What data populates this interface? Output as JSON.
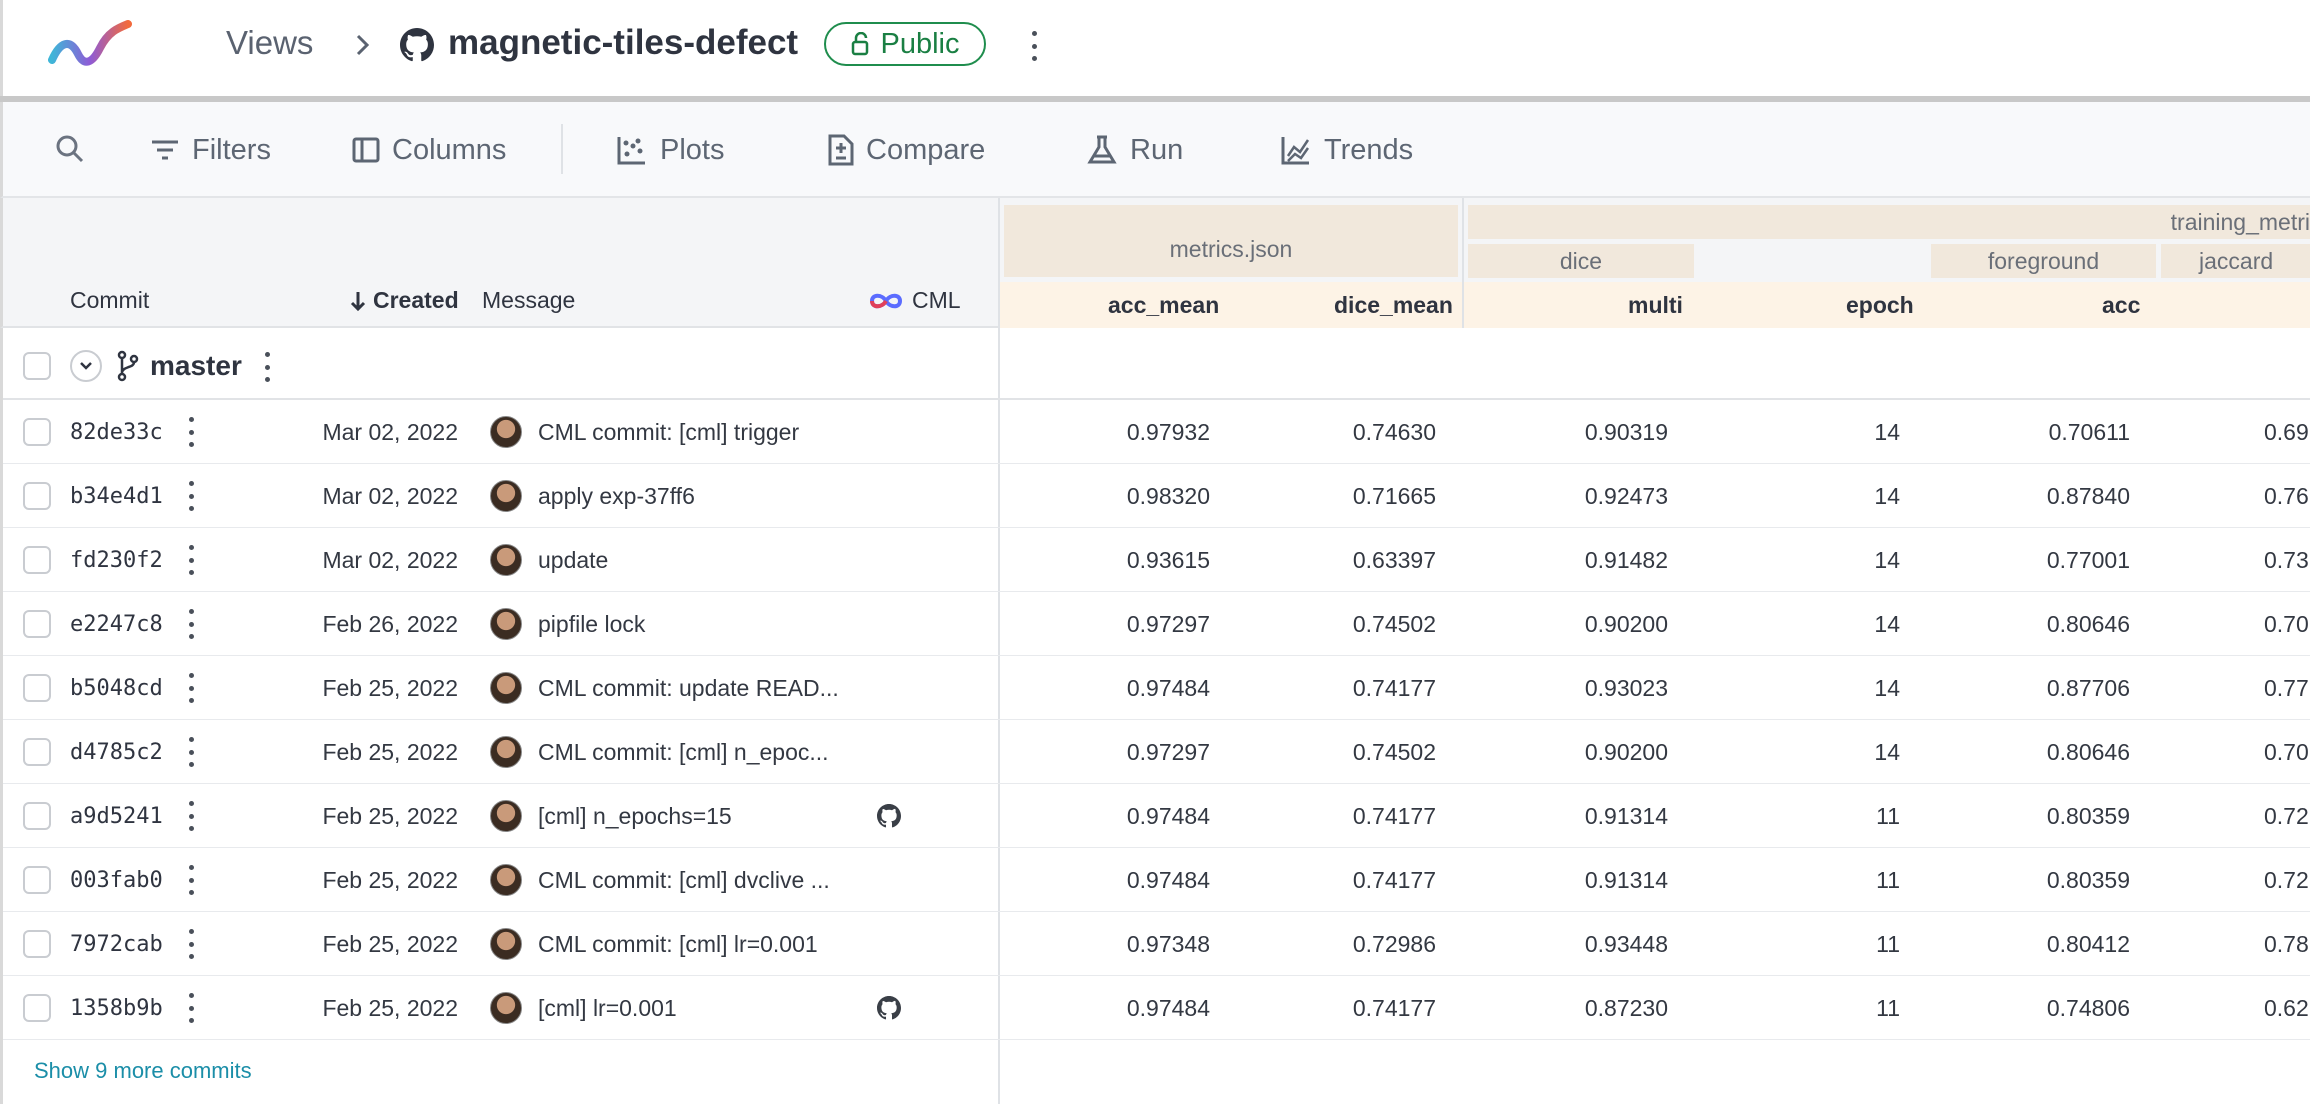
{
  "header": {
    "crumb_views": "Views",
    "repo_name": "magnetic-tiles-defect",
    "visibility_badge": "Public",
    "logo": "dvc-studio-logo"
  },
  "toolbar": {
    "filters": "Filters",
    "columns": "Columns",
    "plots": "Plots",
    "compare": "Compare",
    "run": "Run",
    "trends": "Trends"
  },
  "table": {
    "col_commit": "Commit",
    "col_created": "Created",
    "col_message": "Message",
    "col_cml": "CML",
    "group_metrics_json": "metrics.json",
    "group_training_metrics": "training_metri",
    "subgroup_dice": "dice",
    "subgroup_foreground": "foreground",
    "subgroup_jaccard": "jaccard",
    "metric_cols": [
      "acc_mean",
      "dice_mean",
      "multi",
      "epoch",
      "acc"
    ]
  },
  "branch": {
    "name": "master"
  },
  "rows": [
    {
      "commit": "82de33c",
      "created": "Mar 02, 2022",
      "message": "CML commit: [cml] trigger",
      "cml": false,
      "acc_mean": "0.97932",
      "dice_mean": "0.74630",
      "multi": "0.90319",
      "epoch": "14",
      "acc": "0.70611",
      "next": "0.69"
    },
    {
      "commit": "b34e4d1",
      "created": "Mar 02, 2022",
      "message": "apply exp-37ff6",
      "cml": false,
      "acc_mean": "0.98320",
      "dice_mean": "0.71665",
      "multi": "0.92473",
      "epoch": "14",
      "acc": "0.87840",
      "next": "0.76"
    },
    {
      "commit": "fd230f2",
      "created": "Mar 02, 2022",
      "message": "update",
      "cml": false,
      "acc_mean": "0.93615",
      "dice_mean": "0.63397",
      "multi": "0.91482",
      "epoch": "14",
      "acc": "0.77001",
      "next": "0.73"
    },
    {
      "commit": "e2247c8",
      "created": "Feb 26, 2022",
      "message": "pipfile lock",
      "cml": false,
      "acc_mean": "0.97297",
      "dice_mean": "0.74502",
      "multi": "0.90200",
      "epoch": "14",
      "acc": "0.80646",
      "next": "0.70"
    },
    {
      "commit": "b5048cd",
      "created": "Feb 25, 2022",
      "message": "CML commit: update READ...",
      "cml": false,
      "acc_mean": "0.97484",
      "dice_mean": "0.74177",
      "multi": "0.93023",
      "epoch": "14",
      "acc": "0.87706",
      "next": "0.77"
    },
    {
      "commit": "d4785c2",
      "created": "Feb 25, 2022",
      "message": "CML commit: [cml] n_epoc...",
      "cml": false,
      "acc_mean": "0.97297",
      "dice_mean": "0.74502",
      "multi": "0.90200",
      "epoch": "14",
      "acc": "0.80646",
      "next": "0.70"
    },
    {
      "commit": "a9d5241",
      "created": "Feb 25, 2022",
      "message": "[cml] n_epochs=15",
      "cml": true,
      "acc_mean": "0.97484",
      "dice_mean": "0.74177",
      "multi": "0.91314",
      "epoch": "11",
      "acc": "0.80359",
      "next": "0.72"
    },
    {
      "commit": "003fab0",
      "created": "Feb 25, 2022",
      "message": "CML commit: [cml] dvclive ...",
      "cml": false,
      "acc_mean": "0.97484",
      "dice_mean": "0.74177",
      "multi": "0.91314",
      "epoch": "11",
      "acc": "0.80359",
      "next": "0.72"
    },
    {
      "commit": "7972cab",
      "created": "Feb 25, 2022",
      "message": "CML commit: [cml] lr=0.001",
      "cml": false,
      "acc_mean": "0.97348",
      "dice_mean": "0.72986",
      "multi": "0.93448",
      "epoch": "11",
      "acc": "0.80412",
      "next": "0.78"
    },
    {
      "commit": "1358b9b",
      "created": "Feb 25, 2022",
      "message": "[cml] lr=0.001",
      "cml": true,
      "acc_mean": "0.97484",
      "dice_mean": "0.74177",
      "multi": "0.87230",
      "epoch": "11",
      "acc": "0.74806",
      "next": "0.62"
    }
  ],
  "show_more": "Show 9 more commits",
  "colors": {
    "accent_green": "#1f8d4d",
    "link": "#1b8ea8",
    "group_bg": "#f1e8dc",
    "metric_bg": "#fdf3e6"
  }
}
